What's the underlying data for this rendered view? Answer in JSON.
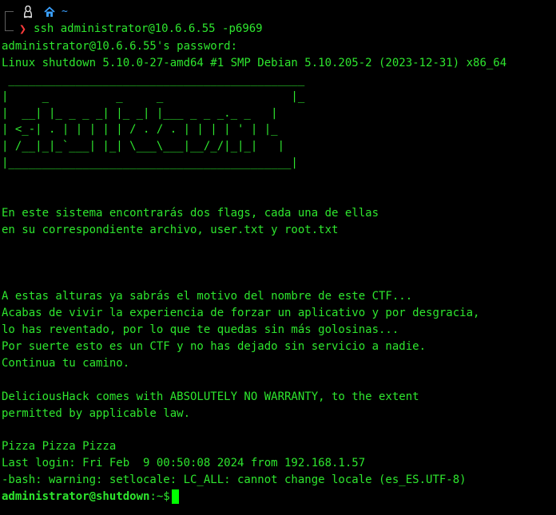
{
  "colors": {
    "background": "#000000",
    "text": "#2ee62e",
    "prompt_chevron": "#ff3b3b",
    "prompt_icon": "#3aa0ff",
    "cursor": "#00ff00"
  },
  "prompt": {
    "icons": [
      "linux-icon",
      "home-icon"
    ],
    "directory": "~",
    "chevron": "❯",
    "command": "ssh administrator@10.6.6.55 -p6969"
  },
  "output": {
    "lines": [
      "administrator@10.6.6.55's password:",
      "Linux shutdown 5.10.0-27-amd64 #1 SMP Debian 5.10.205-2 (2023-12-31) x86_64",
      " ____________________________________________",
      "|     _          _     _                   |_",
      "|  __| |_ _ _ _| |_ _| |___ _ _ _._ _   |",
      "| <_-| . | | | | | / . / . | | | | ' | |_",
      "| /__|_|_`___| |_| \\___\\___|__/_/|_|_|   |",
      "|__________________________________________|",
      "",
      "",
      "En este sistema encontrarás dos flags, cada una de ellas",
      "en su correspondiente archivo, user.txt y root.txt",
      "",
      "",
      "",
      "A estas alturas ya sabrás el motivo del nombre de este CTF...",
      "Acabas de vivir la experiencia de forzar un aplicativo y por desgracia,",
      "lo has reventado, por lo que te quedas sin más golosinas...",
      "Por suerte esto es un CTF y no has dejado sin servicio a nadie.",
      "Continua tu camino.",
      "",
      "DeliciousHack comes with ABSOLUTELY NO WARRANTY, to the extent",
      "permitted by applicable law.",
      "",
      "Pizza Pizza Pizza",
      "Last login: Fri Feb  9 00:50:08 2024 from 192.168.1.57",
      "-bash: warning: setlocale: LC_ALL: cannot change locale (es_ES.UTF-8)"
    ],
    "final_prompt": {
      "user_host": "administrator@shutdown",
      "path": ":~$"
    }
  }
}
